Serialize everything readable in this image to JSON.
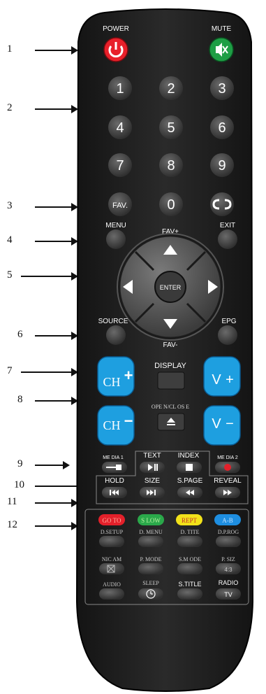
{
  "callouts": [
    "1",
    "2",
    "3",
    "4",
    "5",
    "6",
    "7",
    "8",
    "9",
    "10",
    "11",
    "12"
  ],
  "power": {
    "label": "POWER",
    "color": "#e8202a",
    "icon": "power-icon"
  },
  "mute": {
    "label": "MUTE",
    "color": "#1e9e45",
    "icon": "mute-icon"
  },
  "digits": [
    "1",
    "2",
    "3",
    "4",
    "5",
    "6",
    "7",
    "8",
    "9",
    "0"
  ],
  "fav": "FAV.",
  "recall_icon": "recall-icon",
  "menu": "MENU",
  "exit": "EXIT",
  "fav_plus": "FAV+",
  "fav_minus": "FAV-",
  "enter": "ENTER",
  "source": "SOURCE",
  "epg": "EPG",
  "display": "DISPLAY",
  "ch": "CH",
  "v": "V",
  "plus": "+",
  "minus": "−",
  "blue": "#1e9fe0",
  "open_close": "OPE N/CL OS E",
  "media1": "ME DIA 1",
  "media2": "ME DIA 2",
  "text": "TEXT",
  "index": "INDEX",
  "hold": "HOLD",
  "size": "SIZE",
  "spage": "S.PAGE",
  "reveal": "REVEAL",
  "color_keys": [
    {
      "label": "GO TO",
      "color": "#e3202a",
      "text": "#ffb0a0"
    },
    {
      "label": "S LOW",
      "color": "#2aa84a",
      "text": "#b8f0a0"
    },
    {
      "label": "REPT",
      "color": "#f2e21a",
      "text": "#c0302a"
    },
    {
      "label": "A-B",
      "color": "#1e8ee0",
      "text": "#c0e0ff"
    }
  ],
  "func_row1": [
    "D.SETUP",
    "D. MENU",
    "D. TITE",
    "D.P.ROG"
  ],
  "func_row2": [
    "NIC AM",
    "P. MODE",
    "S.M ODE",
    "P. SIZ"
  ],
  "func_row3": [
    "AUDIO",
    "SLEEP",
    "S.TITLE",
    "RADIO"
  ],
  "aspect": "4:3",
  "tv": "TV"
}
